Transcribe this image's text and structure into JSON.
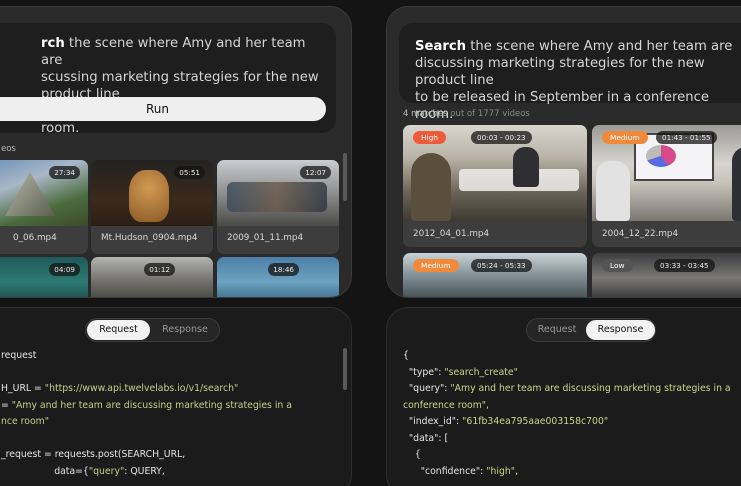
{
  "query": {
    "bold": "Search",
    "left_bold": "rch",
    "left_lines": [
      " the scene where Amy and her team are",
      "scussing marketing strategies for the new product line",
      "e released in September in a conference room."
    ],
    "right_lines": [
      " the scene where Amy and her team are",
      "discussing marketing strategies for the new product line",
      "to be released in September in a conference room."
    ]
  },
  "run_label": "Run",
  "left_section_label": "eos",
  "matches": {
    "count": "4 matches",
    "rest": "out of 1777 videos"
  },
  "left_videos": [
    {
      "name": "0_06.mp4",
      "duration": "27:34"
    },
    {
      "name": "Mt.Hudson_0904.mp4",
      "duration": "05:51"
    },
    {
      "name": "2009_01_11.mp4",
      "duration": "12:07"
    },
    {
      "name": "",
      "duration": "04:09"
    },
    {
      "name": "",
      "duration": "01:12"
    },
    {
      "name": "",
      "duration": "18:46"
    }
  ],
  "right_videos": [
    {
      "name": "2012_04_01.mp4",
      "confidence": "High",
      "range": "00:03 - 00:23"
    },
    {
      "name": "2004_12_22.mp4",
      "confidence": "Medium",
      "range": "01:43 - 01:55"
    },
    {
      "name": "",
      "confidence": "Medium",
      "range": "05:24 - 05:33"
    },
    {
      "name": "",
      "confidence": "Low",
      "range": "03:33 - 03:45"
    }
  ],
  "tabs": {
    "request": "Request",
    "response": "Response"
  },
  "request_code": {
    "l1": "request",
    "l2a": "H_URL = ",
    "l2b": "\"https://www.api.twelvelabs.io/v1/search\"",
    "l3a": "= ",
    "l3b": "\"Amy and her team are discussing marketing strategies in a",
    "l4": "nce room\"",
    "l5": "_request = requests.post(SEARCH_URL,",
    "l6a": "                  data={",
    "l6b": "\"query\"",
    "l6c": ": QUERY,"
  },
  "response_code": {
    "l1": "{",
    "l2a": "  \"type\": ",
    "l2b": "\"search_create\"",
    "l3a": "  \"query\": ",
    "l3b": "\"Amy and her team are discussing marketing strategies in a",
    "l4": "conference room\",",
    "l5a": "  \"index_id\": ",
    "l5b": "\"61fb34ea795aae003158c700\"",
    "l6": "  \"data\": [",
    "l7": "    {",
    "l8a": "      \"confidence\": ",
    "l8b": "\"high\"",
    "l8c": ","
  },
  "colors": {
    "high": "#ee5b3a",
    "medium": "#f08a3a",
    "low": "#555555"
  }
}
